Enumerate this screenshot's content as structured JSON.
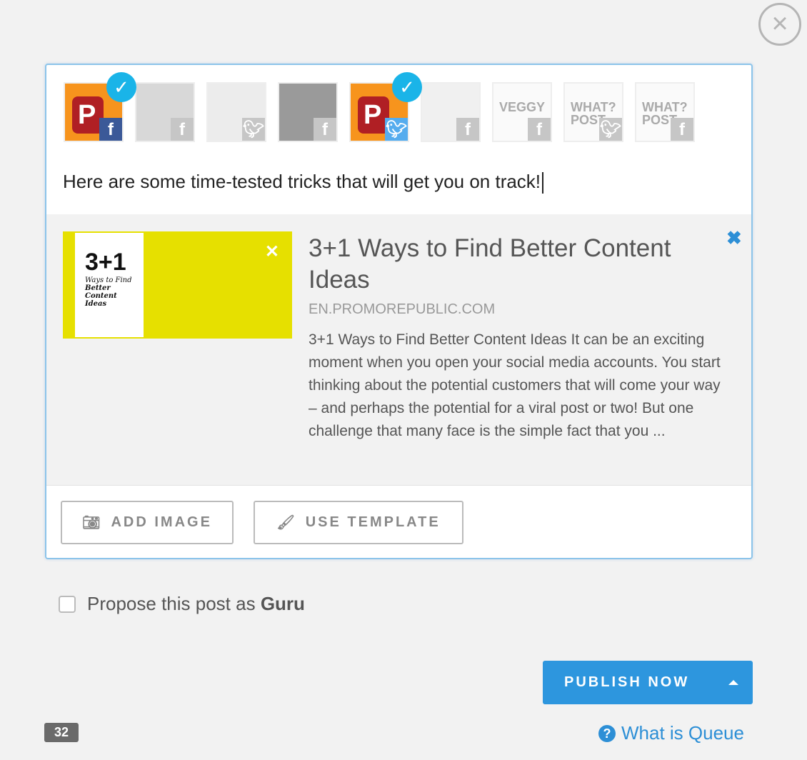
{
  "close_icon": "×",
  "accounts": [
    {
      "name": "promorepublic",
      "network": "facebook",
      "selected": true,
      "color": "#f7941d"
    },
    {
      "name": "person-1",
      "network": "facebook",
      "selected": false,
      "color": "#d8d8d8"
    },
    {
      "name": "person-2",
      "network": "twitter",
      "selected": false,
      "color": "#ececec"
    },
    {
      "name": "sports",
      "network": "facebook",
      "selected": false,
      "color": "#9a9a9a"
    },
    {
      "name": "promorepublic",
      "network": "twitter",
      "selected": true,
      "color": "#f7941d"
    },
    {
      "name": "bottle",
      "network": "facebook",
      "selected": false,
      "color": "#f0f0f0"
    },
    {
      "name": "veggy",
      "network": "facebook",
      "selected": false,
      "color": "#fafafa",
      "label": "VEGGY"
    },
    {
      "name": "whatpost",
      "network": "twitter",
      "selected": false,
      "color": "#fafafa",
      "label": "WHAT? POST"
    },
    {
      "name": "whatpost",
      "network": "facebook",
      "selected": false,
      "color": "#fafafa",
      "label": "WHAT? POST"
    }
  ],
  "post_text": "Here are some time-tested tricks that will get you on track!",
  "link_preview": {
    "thumb_big": "3+1",
    "thumb_line1": "Ways to Find",
    "thumb_line2": "Better",
    "thumb_line3": "Content",
    "thumb_line4": "Ideas",
    "title": "3+1 Ways to Find Better Content Ideas",
    "domain": "EN.PROMOREPUBLIC.COM",
    "description": "3+1 Ways to Find Better Content Ideas It can be an exciting moment when you open your social media accounts. You start thinking about the potential customers that will come your way – and perhaps the potential for a viral post or two! But one challenge that many face is the simple fact that you ..."
  },
  "buttons": {
    "add_image": "ADD IMAGE",
    "use_template": "USE TEMPLATE",
    "publish": "PUBLISH NOW"
  },
  "guru": {
    "label": "Propose this post as ",
    "bold": "Guru",
    "checked": false
  },
  "char_count": "32",
  "queue_link": "What is Queue",
  "colors": {
    "accent": "#2d96de",
    "check": "#1ab4e8",
    "facebook": "#3b5998",
    "twitter": "#55acee"
  }
}
